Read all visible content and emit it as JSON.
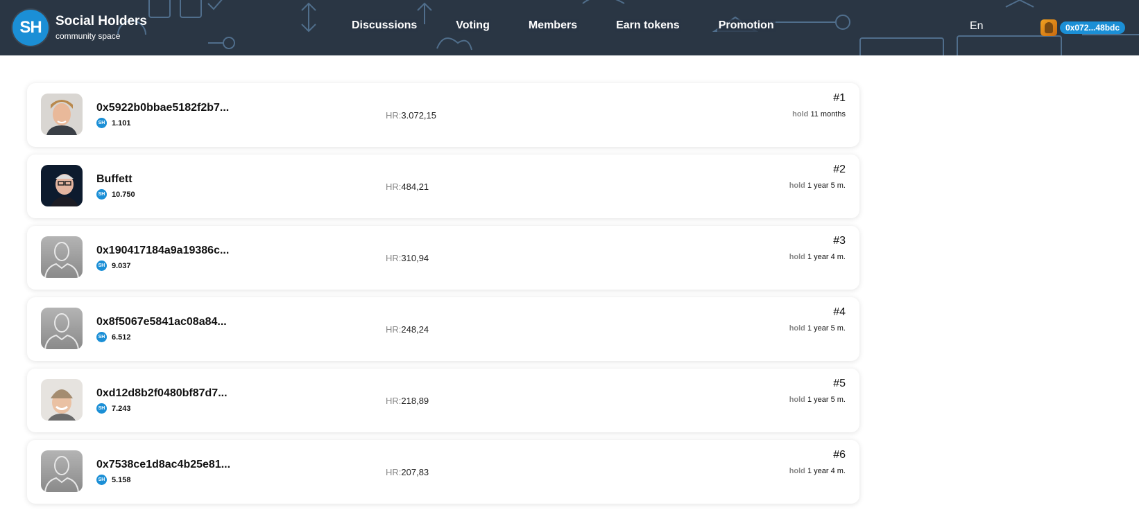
{
  "brand": {
    "logo_text": "SH",
    "title": "Social Holders",
    "subtitle": "community space",
    "accent": "#1b8fd6",
    "header_bg": "#2a3644"
  },
  "nav": [
    "Discussions",
    "Voting",
    "Members",
    "Earn tokens",
    "Promotion"
  ],
  "language": "En",
  "wallet": {
    "address": "0x072...48bdc"
  },
  "token_icon": "SH",
  "hr_label": "HR:",
  "hold_label": "hold",
  "members": [
    {
      "name": "0x5922b0bbae5182f2b7...",
      "balance": "1.101",
      "hr": "3.072,15",
      "rank": "#1",
      "hold": "11 months",
      "avatar": "photo-man-blond"
    },
    {
      "name": "Buffett",
      "balance": "10.750",
      "hr": "484,21",
      "rank": "#2",
      "hold": "1 year 5 m.",
      "avatar": "photo-old-man"
    },
    {
      "name": "0x190417184a9a19386c...",
      "balance": "9.037",
      "hr": "310,94",
      "rank": "#3",
      "hold": "1 year 4 m.",
      "avatar": "default-user"
    },
    {
      "name": "0x8f5067e5841ac08a84...",
      "balance": "6.512",
      "hr": "248,24",
      "rank": "#4",
      "hold": "1 year 5 m.",
      "avatar": "default-user"
    },
    {
      "name": "0xd12d8b2f0480bf87d7...",
      "balance": "7.243",
      "hr": "218,89",
      "rank": "#5",
      "hold": "1 year 5 m.",
      "avatar": "photo-man-beanie"
    },
    {
      "name": "0x7538ce1d8ac4b25e81...",
      "balance": "5.158",
      "hr": "207,83",
      "rank": "#6",
      "hold": "1 year 4 m.",
      "avatar": "default-user"
    }
  ]
}
